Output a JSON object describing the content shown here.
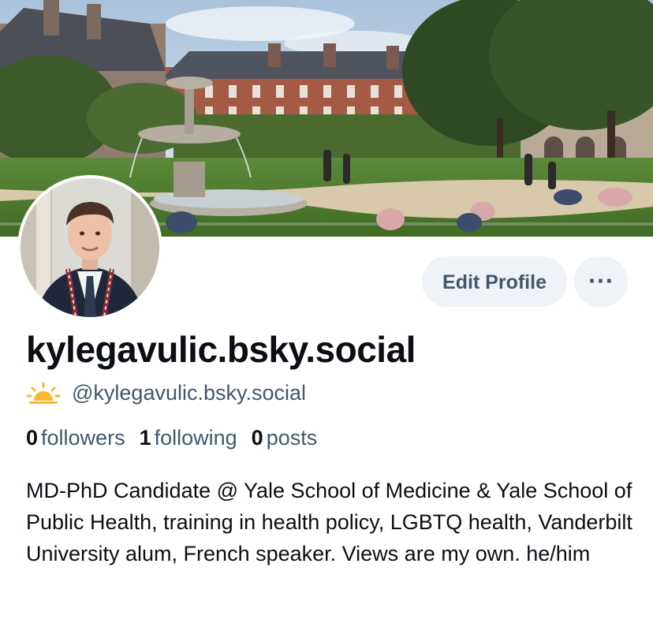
{
  "profile": {
    "display_name": "kylegavulic.bsky.social",
    "handle": "@kylegavulic.bsky.social",
    "bio": "MD-PhD Candidate @ Yale School of Medicine & Yale School of Public Health, training in health policy, LGBTQ health, Vanderbilt University alum, French speaker. Views are my own. he/him",
    "banner_image": "park-fountain-photo",
    "avatar_image": "profile-photo",
    "handle_icon": "sun-icon"
  },
  "stats": {
    "followers_count": "0",
    "followers_label": "followers",
    "following_count": "1",
    "following_label": "following",
    "posts_count": "0",
    "posts_label": "posts"
  },
  "actions": {
    "edit_label": "Edit Profile",
    "more_label": "···"
  },
  "colors": {
    "button_bg": "#eff2f6",
    "muted_text": "#42576c",
    "sun_icon": "#f5b82e"
  }
}
